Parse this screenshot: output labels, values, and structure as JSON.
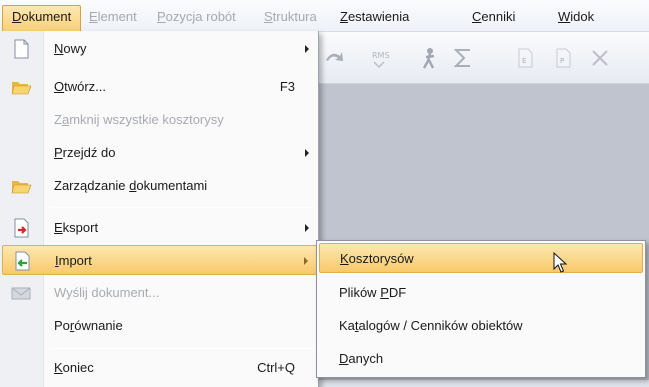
{
  "menubar": {
    "items": [
      {
        "label": "Dokument",
        "mnemonic": "D",
        "rest": "okument",
        "state": "active"
      },
      {
        "label": "Element",
        "mnemonic": "E",
        "rest": "lement",
        "state": "disabled"
      },
      {
        "label": "Pozycja robót",
        "mnemonic": "P",
        "rest": "ozycja robót",
        "state": "disabled"
      },
      {
        "label": "Struktura",
        "mnemonic": "S",
        "rest": "truktura",
        "state": "disabled"
      },
      {
        "label": "Zestawienia",
        "mnemonic": "Z",
        "rest": "estawienia",
        "state": "enabled"
      },
      {
        "label": "Cenniki",
        "mnemonic": "C",
        "rest": "enniki",
        "state": "enabled"
      },
      {
        "label": "Widok",
        "mnemonic": "W",
        "rest": "idok",
        "state": "enabled"
      }
    ]
  },
  "dropdown": {
    "items": [
      {
        "pre": "",
        "mn": "N",
        "post": "owy",
        "shortcut": "",
        "submenu": true,
        "enabled": true,
        "icon": "new-document-icon"
      },
      {
        "pre": "",
        "mn": "O",
        "post": "twórz...",
        "shortcut": "F3",
        "submenu": false,
        "enabled": true,
        "icon": "open-folder-icon"
      },
      {
        "pre": "Z",
        "mn": "a",
        "post": "mknij wszystkie kosztorysy",
        "shortcut": "",
        "submenu": false,
        "enabled": false,
        "icon": ""
      },
      {
        "pre": "",
        "mn": "P",
        "post": "rzejdź do",
        "shortcut": "",
        "submenu": true,
        "enabled": true,
        "icon": ""
      },
      {
        "pre": "Zarządzanie ",
        "mn": "d",
        "post": "okumentami",
        "shortcut": "",
        "submenu": false,
        "enabled": true,
        "icon": "folder-manage-icon"
      },
      {
        "pre": "",
        "mn": "E",
        "post": "ksport",
        "shortcut": "",
        "submenu": true,
        "enabled": true,
        "icon": "export-icon"
      },
      {
        "pre": "",
        "mn": "I",
        "post": "mport",
        "shortcut": "",
        "submenu": true,
        "enabled": true,
        "highlighted": true,
        "icon": "import-icon"
      },
      {
        "pre": "Wyślij dokument",
        "mn": "",
        "post": "...",
        "shortcut": "",
        "submenu": false,
        "enabled": false,
        "icon": "mail-icon"
      },
      {
        "pre": "Po",
        "mn": "r",
        "post": "ównanie",
        "shortcut": "",
        "submenu": false,
        "enabled": true,
        "icon": ""
      },
      {
        "pre": "",
        "mn": "K",
        "post": "oniec",
        "shortcut": "Ctrl+Q",
        "submenu": false,
        "enabled": true,
        "icon": ""
      }
    ]
  },
  "submenu": {
    "items": [
      {
        "pre": "",
        "mn": "K",
        "post": "osztorysów",
        "highlighted": true
      },
      {
        "pre": "Plików ",
        "mn": "P",
        "post": "DF",
        "highlighted": false
      },
      {
        "pre": "Ka",
        "mn": "t",
        "post": "alogów / Cenników obiektów",
        "highlighted": false
      },
      {
        "pre": "",
        "mn": "D",
        "post": "anych",
        "highlighted": false
      }
    ]
  },
  "toolbar": {
    "icons": [
      "redo-icon",
      "rms-icon",
      "worker-icon",
      "sum-icon",
      "e-doc-icon",
      "p-doc-icon",
      "delete-icon"
    ],
    "rms_text": "RMS",
    "e_text": "E",
    "p_text": "P"
  },
  "colors": {
    "highlight_top": "#fde8b0",
    "highlight_bottom": "#f8c96a",
    "workspace": "#bfc4ce"
  }
}
